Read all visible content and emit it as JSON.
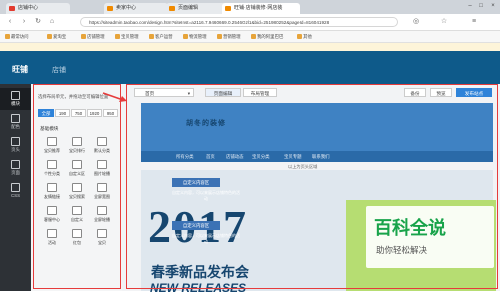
{
  "browser": {
    "tabs": [
      {
        "label": "店铺中心"
      },
      {
        "label": "卖家中心"
      },
      {
        "label": "页面编辑"
      },
      {
        "label": "旺铺·店铺装修·网店装"
      }
    ],
    "url": "https://siteadmin.taobao.com/design.htm?siteInst=a2116.7.9460669.0.2546Gzl1&bid=251980252&pageId=816041928",
    "bookmarks": [
      "最常访问",
      "爱淘宝",
      "店铺管理",
      "宝贝管理",
      "客户运营",
      "物流管理",
      "营销管理",
      "我的阿里巴巴",
      "其他"
    ]
  },
  "app": {
    "logo": "旺铺",
    "logo_sub": "店铺",
    "rail": [
      {
        "label": "模块",
        "icon": "module-icon"
      },
      {
        "label": "配色",
        "icon": "palette-icon"
      },
      {
        "label": "页头",
        "icon": "header-icon"
      },
      {
        "label": "页面",
        "icon": "page-icon"
      },
      {
        "label": "CSS",
        "icon": "css-icon"
      }
    ]
  },
  "panel": {
    "hint": "选择布局单元，并拖动至可编辑位置",
    "widths": [
      {
        "label": "全部",
        "active": true
      },
      {
        "label": "190",
        "active": false
      },
      {
        "label": "750",
        "active": false
      },
      {
        "label": "1920",
        "active": false
      },
      {
        "label": "950",
        "active": false
      }
    ],
    "section_title": "基础模块",
    "modules": [
      "宝贝推荐",
      "宝贝排行",
      "默认分类",
      "个性分类",
      "自定义区",
      "图片轮播",
      "友情链接",
      "宝贝搜索",
      "全屏宽图",
      "客服中心",
      "自定义",
      "全屏轮播",
      "活动",
      "红包",
      "宝贝"
    ]
  },
  "toolbar": {
    "page_select": "首页",
    "tab_edit": "页面编辑",
    "tab_layout": "布局管理",
    "btn_backup": "备份",
    "btn_preview": "预览",
    "btn_publish": "发布站点"
  },
  "shop": {
    "name": "胡冬的装修",
    "nav": [
      "所有分类",
      "首页",
      "店铺动态",
      "宝贝分类",
      "宝贝专题",
      "联系我们"
    ],
    "under_nav": "以上为页头区域",
    "custom_block_1": "自定义内容区",
    "custom_text_1": "自定义内容，可以来展示店铺特色的活动",
    "custom_block_2": "自定义内容区",
    "custom_text_2": "自定义内容，可以来展示店铺特色的活动",
    "hero_year": "2017",
    "hero_title": "春季新品发布会",
    "hero_sub": "NEW RELEASES"
  },
  "watermark": {
    "title": "百科全说",
    "subtitle": "助你轻松解决"
  }
}
